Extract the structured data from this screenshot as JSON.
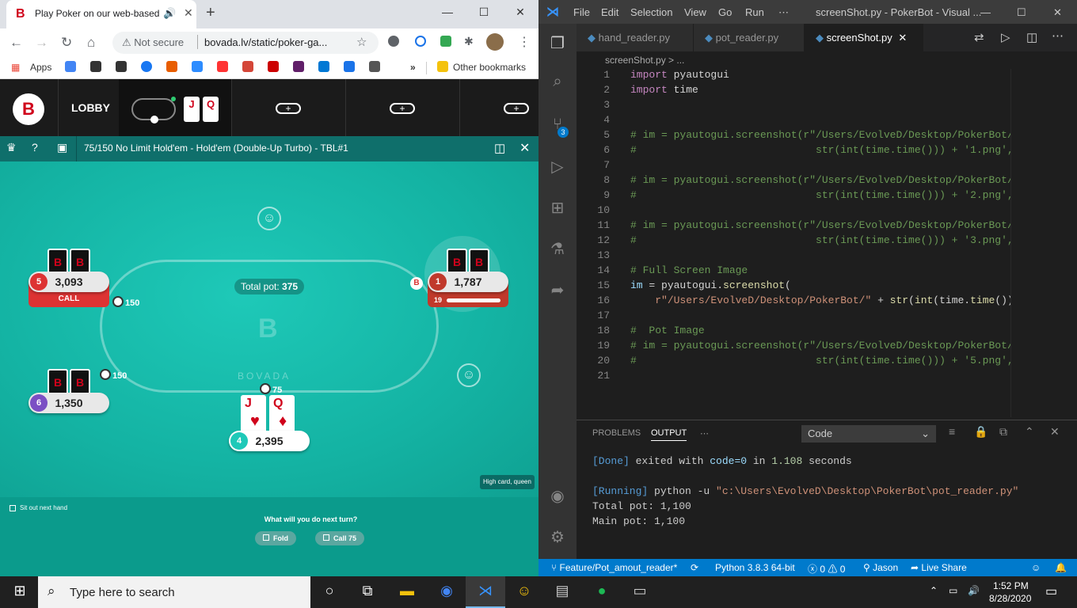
{
  "chrome": {
    "tab_title": "Play Poker on our web-based",
    "url": "bovada.lv/static/poker-ga...",
    "not_secure": "Not secure",
    "bookmarks": [
      "Apps",
      "Other bookmarks"
    ]
  },
  "poker": {
    "lobby": "LOBBY",
    "table_title": "75/150 No Limit Hold'em - Hold'em (Double-Up Turbo) - TBL#1",
    "tab_cards": [
      "J",
      "Q"
    ],
    "total_pot_label": "Total pot:",
    "total_pot": "375",
    "brand": "BOVADA",
    "seats": [
      {
        "no": "5",
        "stack": "3,093",
        "action": "CALL",
        "bet": "150"
      },
      {
        "no": "1",
        "stack": "1,787",
        "timer": "19"
      },
      {
        "no": "6",
        "stack": "1,350",
        "bet": "150"
      },
      {
        "no": "4",
        "stack": "2,395",
        "bet": "75"
      }
    ],
    "hero_cards": [
      "J",
      "Q"
    ],
    "hand_strength": "High card, queen",
    "sit_out": "Sit out next hand",
    "prompt": "What will you do next turn?",
    "fold": "Fold",
    "call": "Call 75"
  },
  "vscode": {
    "menu": [
      "File",
      "Edit",
      "Selection",
      "View",
      "Go",
      "Run",
      "⋯"
    ],
    "title": "screenShot.py - PokerBot - Visual ...",
    "tabs": [
      "hand_reader.py",
      "pot_reader.py",
      "screenShot.py"
    ],
    "breadcrumb": "screenShot.py > ...",
    "badge": "3",
    "panel_tabs": [
      "PROBLEMS",
      "OUTPUT",
      "⋯"
    ],
    "output_channel": "Code",
    "output": [
      "[Done] exited with code=0 in 1.108 seconds",
      "",
      "[Running] python -u \"c:\\Users\\EvolveD\\Desktop\\PokerBot\\pot_reader.py\"",
      "Total pot: 1,100",
      "Main pot: 1,100"
    ],
    "status": {
      "branch": "Feature/Pot_amout_reader*",
      "python": "Python 3.8.3 64-bit",
      "errors": "0",
      "warnings": "0",
      "user": "Jason",
      "share": "Live Share"
    }
  },
  "taskbar": {
    "search": "Type here to search",
    "time": "1:52 PM",
    "date": "8/28/2020"
  }
}
